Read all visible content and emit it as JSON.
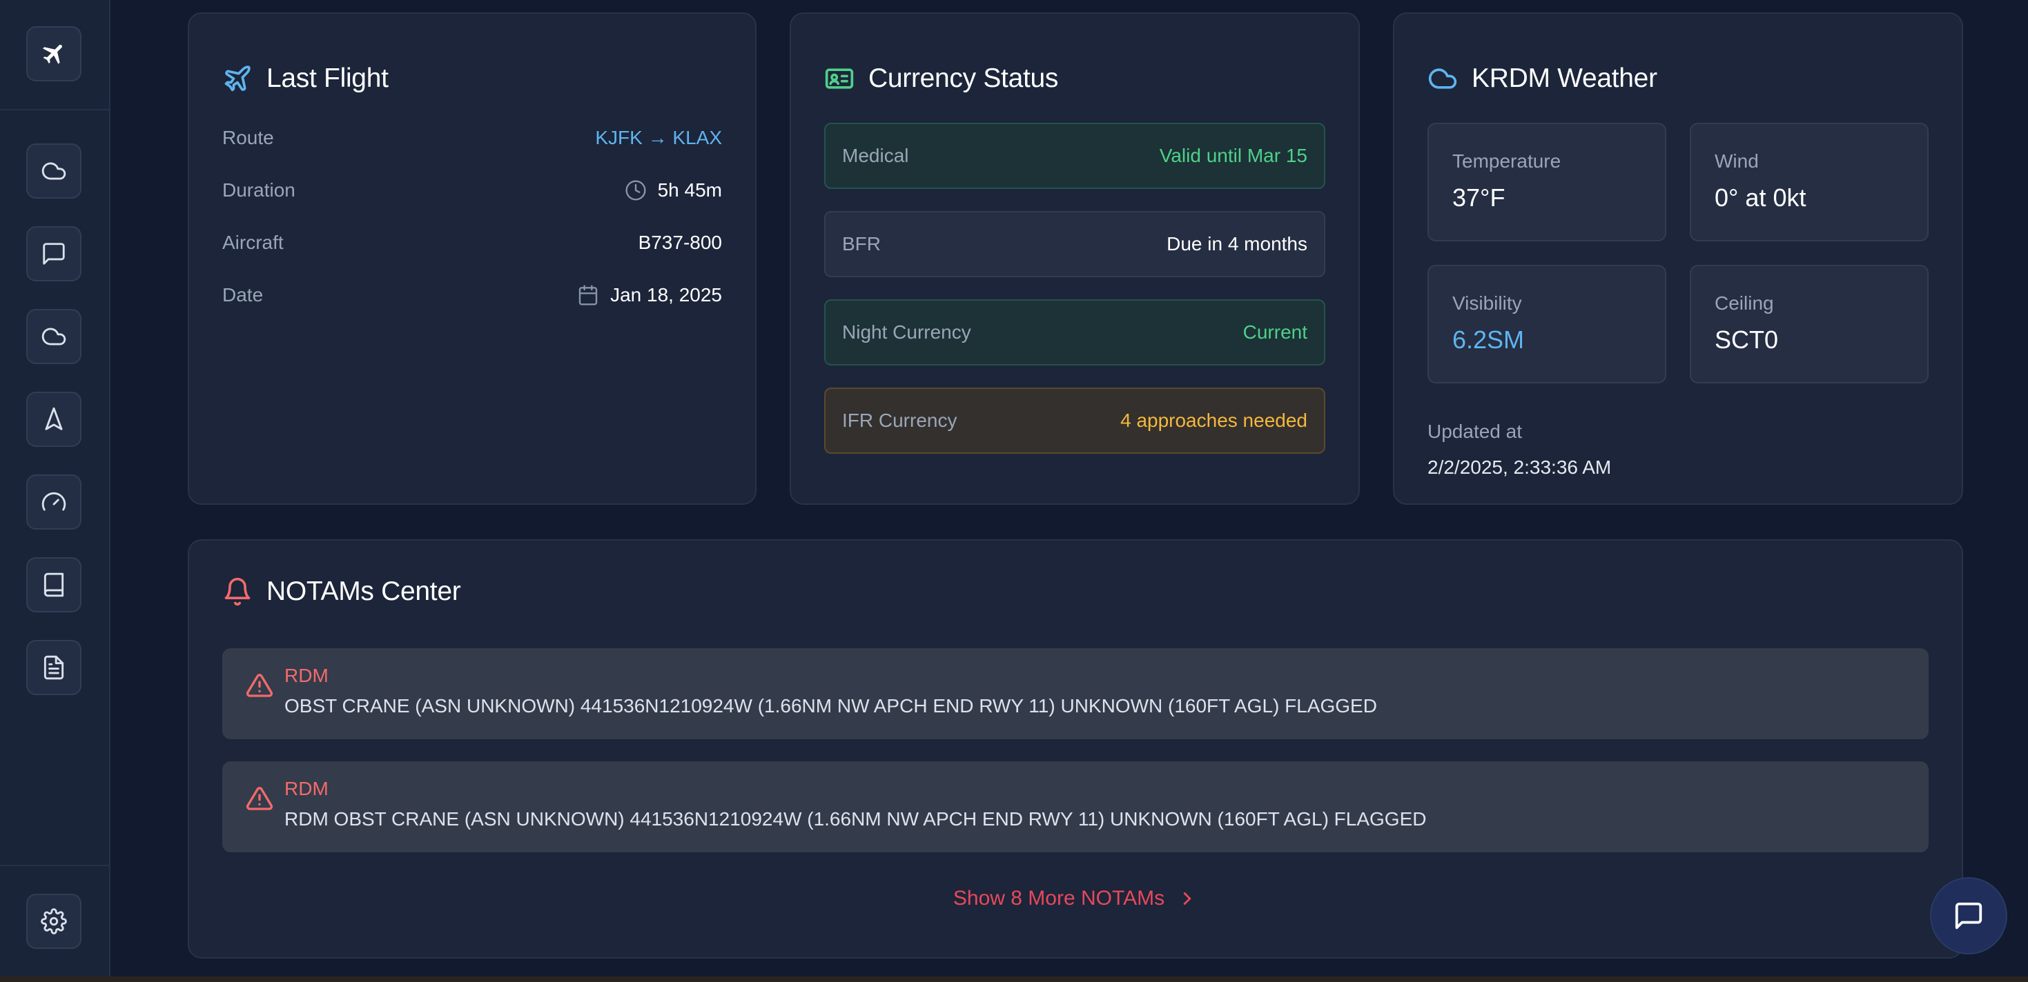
{
  "sidebar": {
    "items": [
      {
        "icon": "plane-icon"
      },
      {
        "icon": "cloud-icon"
      },
      {
        "icon": "chat-icon"
      },
      {
        "icon": "cloud-icon"
      },
      {
        "icon": "navigation-icon"
      },
      {
        "icon": "gauge-icon"
      },
      {
        "icon": "book-icon"
      },
      {
        "icon": "document-icon"
      },
      {
        "icon": "gear-icon"
      }
    ]
  },
  "last_flight": {
    "title": "Last Flight",
    "title_icon": "plane-icon",
    "rows": [
      {
        "label": "Route",
        "value": "KJFK → KLAX"
      },
      {
        "label": "Duration",
        "value": "5h 45m",
        "icon": "clock-icon"
      },
      {
        "label": "Aircraft",
        "value": "B737-800"
      },
      {
        "label": "Date",
        "value": "Jan 18, 2025",
        "icon": "calendar-icon"
      }
    ]
  },
  "currency": {
    "title": "Currency Status",
    "title_icon": "id-card-icon",
    "rows": [
      {
        "label": "Medical",
        "value": "Valid until Mar 15",
        "status": "green"
      },
      {
        "label": "BFR",
        "value": "Due in 4 months",
        "status": "neutral"
      },
      {
        "label": "Night Currency",
        "value": "Current",
        "status": "green"
      },
      {
        "label": "IFR Currency",
        "value": "4 approaches needed",
        "status": "amber"
      }
    ]
  },
  "weather": {
    "title": "KRDM Weather",
    "title_icon": "cloud-icon",
    "tiles": [
      {
        "label": "Temperature",
        "value": "37°F"
      },
      {
        "label": "Wind",
        "value": "0° at 0kt"
      },
      {
        "label": "Visibility",
        "value": "6.2SM"
      },
      {
        "label": "Ceiling",
        "value": "SCT0"
      }
    ],
    "updated_label": "Updated at",
    "updated_value": "2/2/2025, 2:33:36 AM"
  },
  "notams": {
    "title": "NOTAMs Center",
    "title_icon": "bell-icon",
    "items": [
      {
        "code": "RDM",
        "text": "OBST CRANE (ASN UNKNOWN) 441536N1210924W (1.66NM NW APCH END RWY 11) UNKNOWN (160FT AGL) FLAGGED"
      },
      {
        "code": "RDM",
        "text": "RDM OBST CRANE (ASN UNKNOWN) 441536N1210924W (1.66NM NW APCH END RWY 11) UNKNOWN (160FT AGL) FLAGGED"
      }
    ],
    "show_more": "Show 8 More NOTAMs"
  },
  "colors": {
    "accent_blue": "#5fb4f0",
    "success_green": "#4fd08a",
    "warning_amber": "#f5b83d",
    "alert_red": "#e8485b"
  }
}
